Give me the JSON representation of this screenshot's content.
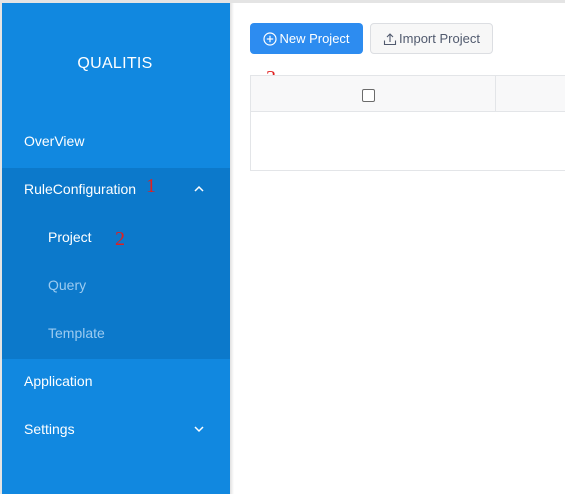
{
  "sidebar": {
    "logo": "QUALITIS",
    "items": [
      {
        "label": "OverView"
      },
      {
        "label": "RuleConfiguration",
        "expanded": true,
        "chevron": "chevron-up-icon"
      },
      {
        "label": "Application"
      },
      {
        "label": "Settings",
        "chevron": "chevron-down-icon"
      }
    ],
    "submenu": [
      {
        "label": "Project",
        "active": true
      },
      {
        "label": "Query"
      },
      {
        "label": "Template"
      }
    ]
  },
  "toolbar": {
    "new_project_label": "New Project",
    "new_project_icon": "plus-circle-icon",
    "import_project_label": "Import Project",
    "import_project_icon": "upload-icon"
  },
  "annotations": {
    "one": "1",
    "two": "2",
    "three": "3"
  },
  "colors": {
    "sidebar": "#1188e0",
    "submenu": "#0c79cb",
    "primary": "#2d8cf0",
    "annotation": "#e02020"
  }
}
